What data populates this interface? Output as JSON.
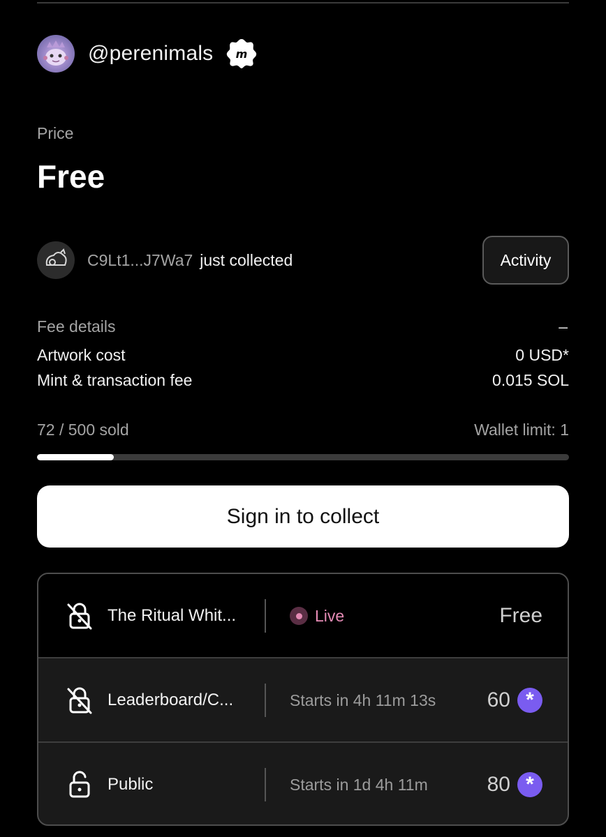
{
  "creator": {
    "handle": "@perenimals",
    "badge_icon": "m-badge-icon"
  },
  "price": {
    "label": "Price",
    "value": "Free"
  },
  "recent": {
    "address": "C9Lt1...J7Wa7",
    "action": "just collected",
    "activity_label": "Activity"
  },
  "fees": {
    "title": "Fee details",
    "toggle": "–",
    "rows": [
      {
        "label": "Artwork cost",
        "value": "0 USD*"
      },
      {
        "label": "Mint & transaction fee",
        "value": "0.015 SOL"
      }
    ]
  },
  "supply": {
    "sold_text": "72 / 500 sold",
    "wallet_limit": "Wallet limit: 1",
    "progress_fraction": 0.144
  },
  "cta": {
    "label": "Sign in to collect"
  },
  "phases": [
    {
      "name": "The Ritual Whit...",
      "status": "Live",
      "price": "Free",
      "locked": true,
      "live": true
    },
    {
      "name": "Leaderboard/C...",
      "status": "Starts in 4h 11m 13s",
      "price": "60",
      "locked": true,
      "live": false
    },
    {
      "name": "Public",
      "status": "Starts in 1d 4h 11m",
      "price": "80",
      "locked": false,
      "live": false
    }
  ],
  "colors": {
    "live": "#e58bb5",
    "token": "#7a5cf0",
    "background": "#000000"
  }
}
